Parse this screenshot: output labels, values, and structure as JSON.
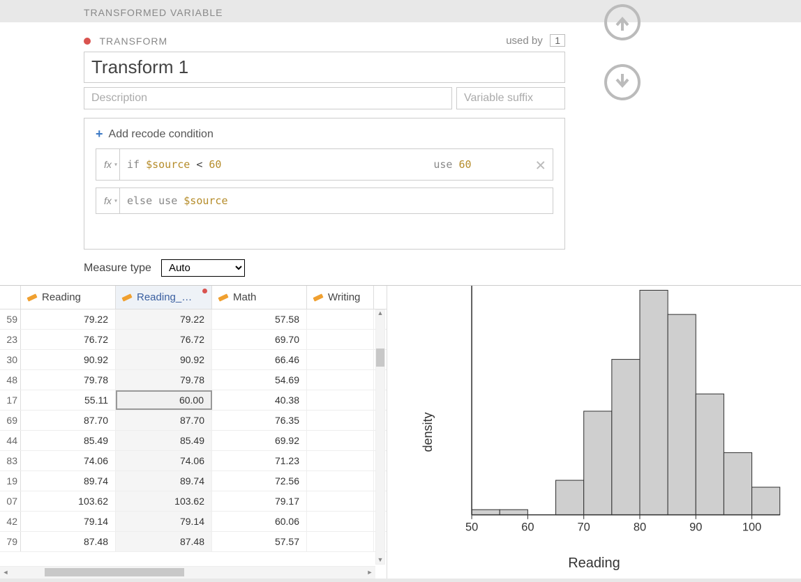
{
  "header": {
    "section_title": "TRANSFORMED VARIABLE"
  },
  "transform": {
    "label": "TRANSFORM",
    "used_by_label": "used by",
    "used_by_count": "1",
    "name": "Transform 1",
    "description_placeholder": "Description",
    "suffix_placeholder": "Variable suffix",
    "add_recode_label": "Add recode condition",
    "fx_label": "fx",
    "condition": {
      "if_kw": "if",
      "src_var": "$source",
      "op": "<",
      "threshold": "60",
      "use_kw": "use",
      "use_val": "60"
    },
    "else_line": {
      "else_kw": "else use",
      "src_var": "$source"
    },
    "measure_label": "Measure type",
    "measure_value": "Auto"
  },
  "table": {
    "columns": [
      "Reading",
      "Reading_…",
      "Math",
      "Writing"
    ],
    "selected_col_index": 1,
    "highlight_row_index": 4,
    "rows": [
      {
        "n": "59",
        "c": [
          "79.22",
          "79.22",
          "57.58",
          ""
        ]
      },
      {
        "n": "23",
        "c": [
          "76.72",
          "76.72",
          "69.70",
          ""
        ]
      },
      {
        "n": "30",
        "c": [
          "90.92",
          "90.92",
          "66.46",
          ""
        ]
      },
      {
        "n": "48",
        "c": [
          "79.78",
          "79.78",
          "54.69",
          ""
        ]
      },
      {
        "n": "17",
        "c": [
          "55.11",
          "60.00",
          "40.38",
          ""
        ]
      },
      {
        "n": "69",
        "c": [
          "87.70",
          "87.70",
          "76.35",
          ""
        ]
      },
      {
        "n": "44",
        "c": [
          "85.49",
          "85.49",
          "69.92",
          ""
        ]
      },
      {
        "n": "83",
        "c": [
          "74.06",
          "74.06",
          "71.23",
          ""
        ]
      },
      {
        "n": "19",
        "c": [
          "89.74",
          "89.74",
          "72.56",
          ""
        ]
      },
      {
        "n": "07",
        "c": [
          "103.62",
          "103.62",
          "79.17",
          ""
        ]
      },
      {
        "n": "42",
        "c": [
          "79.14",
          "79.14",
          "60.06",
          ""
        ]
      },
      {
        "n": "79",
        "c": [
          "87.48",
          "87.48",
          "57.57",
          ""
        ]
      }
    ]
  },
  "chart_data": {
    "type": "bar",
    "title": "",
    "xlabel": "Reading",
    "ylabel": "density",
    "xlim": [
      50,
      105
    ],
    "x_ticks": [
      50,
      60,
      70,
      80,
      90,
      100
    ],
    "bin_width": 5,
    "categories": [
      52.5,
      57.5,
      62.5,
      67.5,
      72.5,
      77.5,
      82.5,
      87.5,
      92.5,
      97.5,
      102.5
    ],
    "values": [
      0.0015,
      0.0015,
      0,
      0.01,
      0.03,
      0.045,
      0.065,
      0.058,
      0.035,
      0.018,
      0.008
    ]
  }
}
